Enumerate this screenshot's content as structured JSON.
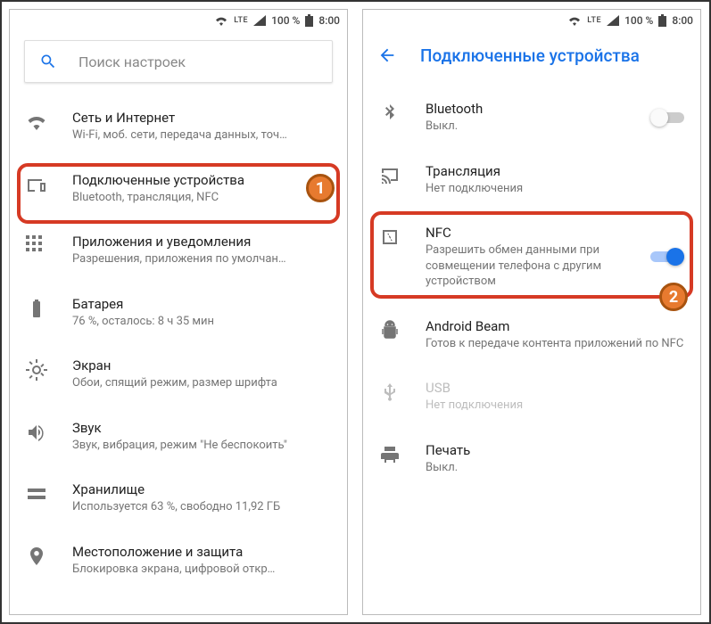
{
  "statusbar": {
    "lte": "LTE",
    "battery_pct": "100 %",
    "time": "8:00"
  },
  "left": {
    "search_placeholder": "Поиск настроек",
    "items": [
      {
        "title": "Сеть и Интернет",
        "sub": "Wi-Fi, моб. сети, передача данных, точ…"
      },
      {
        "title": "Подключенные устройства",
        "sub": "Bluetooth, трансляция, NFC"
      },
      {
        "title": "Приложения и уведомления",
        "sub": "Разрешения, приложения по умолчан…"
      },
      {
        "title": "Батарея",
        "sub": "76 %, осталось: 8 ч 35 мин"
      },
      {
        "title": "Экран",
        "sub": "Обои, спящий режим, размер шрифта"
      },
      {
        "title": "Звук",
        "sub": "Звук, вибрация, режим \"Не беспокоить\""
      },
      {
        "title": "Хранилище",
        "sub": "Используется 63 %, свободно 11,92 ГБ"
      },
      {
        "title": "Местоположение и защита",
        "sub": "Блокировка экрана, цифровой откр…"
      }
    ]
  },
  "right": {
    "title": "Подключенные устройства",
    "items": [
      {
        "title": "Bluetooth",
        "sub": "Выкл."
      },
      {
        "title": "Трансляция",
        "sub": "Нет подключения"
      },
      {
        "title": "NFC",
        "sub": "Разрешить обмен данными при совмещении телефона с другим устройством"
      },
      {
        "title": "Android Beam",
        "sub": "Готов к передаче контента приложений по NFC"
      },
      {
        "title": "USB",
        "sub": "Нет подключения"
      },
      {
        "title": "Печать",
        "sub": "Выкл."
      }
    ]
  },
  "badges": {
    "one": "1",
    "two": "2"
  }
}
